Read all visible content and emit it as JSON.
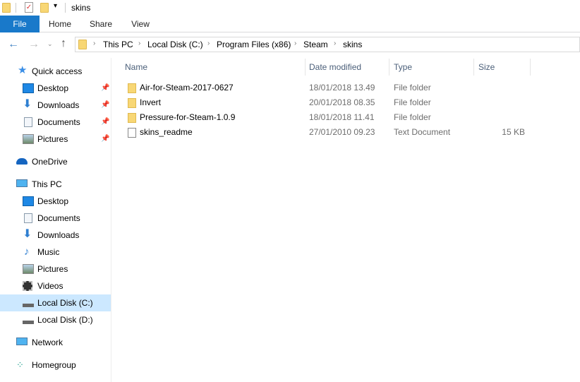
{
  "window": {
    "title": "skins"
  },
  "ribbon": {
    "tabs": [
      "File",
      "Home",
      "Share",
      "View"
    ]
  },
  "address": {
    "crumbs": [
      "This PC",
      "Local Disk (C:)",
      "Program Files (x86)",
      "Steam",
      "skins"
    ]
  },
  "nav": {
    "quick_access": "Quick access",
    "quick_items": [
      "Desktop",
      "Downloads",
      "Documents",
      "Pictures"
    ],
    "onedrive": "OneDrive",
    "this_pc": "This PC",
    "pc_items": [
      "Desktop",
      "Documents",
      "Downloads",
      "Music",
      "Pictures",
      "Videos",
      "Local Disk (C:)",
      "Local Disk (D:)"
    ],
    "network": "Network",
    "homegroup": "Homegroup",
    "selected": "Local Disk (C:)"
  },
  "columns": {
    "name": "Name",
    "date": "Date modified",
    "type": "Type",
    "size": "Size"
  },
  "files": [
    {
      "name": "Air-for-Steam-2017-0627",
      "date": "18/01/2018 13.49",
      "type": "File folder",
      "size": ""
    },
    {
      "name": "Invert",
      "date": "20/01/2018 08.35",
      "type": "File folder",
      "size": ""
    },
    {
      "name": "Pressure-for-Steam-1.0.9",
      "date": "18/01/2018 11.41",
      "type": "File folder",
      "size": ""
    },
    {
      "name": "skins_readme",
      "date": "27/01/2010 09.23",
      "type": "Text Document",
      "size": "15 KB"
    }
  ],
  "colors": {
    "accent": "#1979ca",
    "selected": "#cce8ff"
  }
}
